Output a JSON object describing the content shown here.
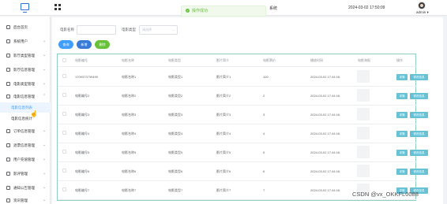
{
  "topbar": {
    "toast": "操作成功",
    "system_name": "系统",
    "datetime": "2024-03-02 17:50:09",
    "username": "admin"
  },
  "sidebar": {
    "items": [
      {
        "label": "后台首页",
        "icon": "home-icon"
      },
      {
        "label": "系统用户",
        "icon": "user-icon"
      },
      {
        "label": "影厅类型管理",
        "icon": "folder-icon"
      },
      {
        "label": "影厅信息管理",
        "icon": "folder-icon"
      },
      {
        "label": "电影类型管理",
        "icon": "folder-icon"
      },
      {
        "label": "电影信息管理",
        "icon": "folder-icon"
      },
      {
        "label": "订单信息管理",
        "icon": "folder-icon"
      },
      {
        "label": "退票信息管理",
        "icon": "folder-icon"
      },
      {
        "label": "用户充值管理",
        "icon": "folder-icon"
      },
      {
        "label": "影评管理",
        "icon": "folder-icon"
      },
      {
        "label": "通知公告管理",
        "icon": "folder-icon"
      },
      {
        "label": "资讯管理",
        "icon": "folder-icon"
      }
    ],
    "sub_items": [
      {
        "label": "电影信息列表",
        "active": true
      },
      {
        "label": "电影信息统计",
        "active": false
      }
    ]
  },
  "search": {
    "name_label": "电影名称",
    "name_placeholder": "",
    "type_label": "电影类型",
    "type_placeholder": "请选择"
  },
  "buttons": {
    "search": "查询",
    "add": "新增",
    "delete": "删除"
  },
  "table": {
    "headers": [
      "电影编号",
      "电影名称",
      "电影类型",
      "影片简介",
      "电影票价",
      "播放时间",
      "电影海报",
      "操作"
    ],
    "rows": [
      {
        "id": "1709373739490",
        "name": "电影名称1",
        "type": "电影类型1",
        "intro": "影片简介1",
        "price": "100",
        "time": "2024-03-02 17:44:16"
      },
      {
        "id": "电影编号2",
        "name": "电影名称2",
        "type": "电影类型2",
        "intro": "影片简介2",
        "price": "2",
        "time": "2024-03-02 17:44:16"
      },
      {
        "id": "电影编号3",
        "name": "电影名称3",
        "type": "电影类型3",
        "intro": "影片简介3",
        "price": "3",
        "time": "2024-03-02 17:44:16"
      },
      {
        "id": "电影编号4",
        "name": "电影名称4",
        "type": "电影类型4",
        "intro": "影片简介4",
        "price": "4",
        "time": "2024-03-02 17:44:16"
      },
      {
        "id": "电影编号5",
        "name": "电影名称5",
        "type": "电影类型5",
        "intro": "影片简介5",
        "price": "5",
        "time": "2024-03-02 17:44:16"
      },
      {
        "id": "电影编号6",
        "name": "电影名称6",
        "type": "电影类型6",
        "intro": "影片简介6",
        "price": "6",
        "time": "2024-03-02 17:44:16"
      },
      {
        "id": "电影编号7",
        "name": "电影名称7",
        "type": "电影类型7",
        "intro": "影片简介7",
        "price": "7",
        "time": "2024-03-02 17:44:16"
      }
    ],
    "op_detail": "详情",
    "op_edit": "修改信息"
  },
  "watermark": "CSDN @vx_OKKFL0088",
  "colors": {
    "primary": "#409eff",
    "success": "#67c23a",
    "op_button": "#67c2d6",
    "table_border": "#8fcfbd"
  }
}
